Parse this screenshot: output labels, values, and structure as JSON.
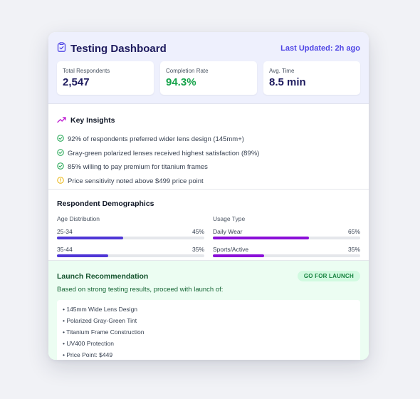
{
  "header": {
    "title": "Testing Dashboard",
    "last_updated": "Last Updated: 2h ago"
  },
  "stats": [
    {
      "label": "Total Respondents",
      "value": "2,547",
      "color": "#1e1b5e"
    },
    {
      "label": "Completion Rate",
      "value": "94.3%",
      "color": "#16a34a"
    },
    {
      "label": "Avg. Time",
      "value": "8.5 min",
      "color": "#1e1b5e"
    }
  ],
  "insights": {
    "title": "Key Insights",
    "items": [
      {
        "text": "92% of respondents preferred wider lens design (145mm+)",
        "icon": "check-circle-icon"
      },
      {
        "text": "Gray-green polarized lenses received highest satisfaction (89%)",
        "icon": "check-circle-icon"
      },
      {
        "text": "85% willing to pay premium for titanium frames",
        "icon": "check-circle-icon"
      },
      {
        "text": "Price sensitivity noted above $499 price point",
        "icon": "alert-circle-icon"
      }
    ]
  },
  "demographics": {
    "title": "Respondent Demographics",
    "age": {
      "title": "Age Distribution",
      "color": "#4f36d6",
      "rows": [
        {
          "label": "25-34",
          "percent": "45%",
          "value": 45
        },
        {
          "label": "35-44",
          "percent": "35%",
          "value": 35
        }
      ]
    },
    "usage": {
      "title": "Usage Type",
      "color": "#8a0fd8",
      "rows": [
        {
          "label": "Daily Wear",
          "percent": "65%",
          "value": 65
        },
        {
          "label": "Sports/Active",
          "percent": "35%",
          "value": 35
        }
      ]
    }
  },
  "launch": {
    "title": "Launch Recommendation",
    "badge": "GO FOR LAUNCH",
    "description": "Based on strong testing results, proceed with launch of:",
    "items": [
      "• 145mm Wide Lens Design",
      "• Polarized Gray-Green Tint",
      "• Titanium Frame Construction",
      "• UV400 Protection",
      "• Price Point: $449"
    ]
  }
}
